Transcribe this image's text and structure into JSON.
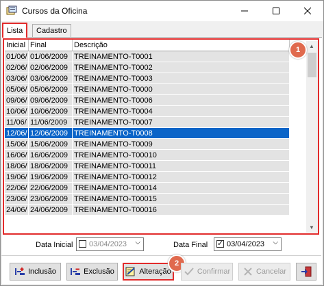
{
  "window": {
    "title": "Cursos da Oficina"
  },
  "tabs": [
    {
      "label": "Lista",
      "active": true
    },
    {
      "label": "Cadastro",
      "active": false
    }
  ],
  "grid": {
    "columns": [
      "Inicial",
      "Final",
      "Descrição"
    ],
    "rows": [
      [
        "01/06/",
        "01/06/2009",
        "TREINAMENTO-T0001"
      ],
      [
        "02/06/",
        "02/06/2009",
        "TREINAMENTO-T0002"
      ],
      [
        "03/06/",
        "03/06/2009",
        "TREINAMENTO-T0003"
      ],
      [
        "05/06/",
        "05/06/2009",
        "TREINAMENTO-T0000"
      ],
      [
        "09/06/",
        "09/06/2009",
        "TREINAMENTO-T0006"
      ],
      [
        "10/06/",
        "10/06/2009",
        "TREINAMENTO-T0004"
      ],
      [
        "11/06/",
        "11/06/2009",
        "TREINAMENTO-T0007"
      ],
      [
        "12/06/",
        "12/06/2009",
        "TREINAMENTO-T0008"
      ],
      [
        "15/06/",
        "15/06/2009",
        "TREINAMENTO-T0009"
      ],
      [
        "16/06/",
        "16/06/2009",
        "TREINAMENTO-T00010"
      ],
      [
        "18/06/",
        "18/06/2009",
        "TREINAMENTO-T00011"
      ],
      [
        "19/06/",
        "19/06/2009",
        "TREINAMENTO-T00012"
      ],
      [
        "22/06/",
        "22/06/2009",
        "TREINAMENTO-T00014"
      ],
      [
        "23/06/",
        "23/06/2009",
        "TREINAMENTO-T00015"
      ],
      [
        "24/06/",
        "24/06/2009",
        "TREINAMENTO-T00016"
      ]
    ],
    "selected_row": 7
  },
  "filters": {
    "data_inicial": {
      "label": "Data Inicial",
      "value": "03/04/2023",
      "checked": false
    },
    "data_final": {
      "label": "Data Final",
      "value": "03/04/2023",
      "checked": true
    }
  },
  "toolbar": {
    "inclusao": "Inclusão",
    "exclusao": "Exclusão",
    "alteracao": "Alteração",
    "confirmar": "Confirmar",
    "cancelar": "Cancelar"
  },
  "annotations": {
    "badge_1": "1",
    "badge_2": "2"
  },
  "colors": {
    "highlight": "#e22b2b",
    "selection": "#0a64c8",
    "badge": "#e06a4e"
  }
}
